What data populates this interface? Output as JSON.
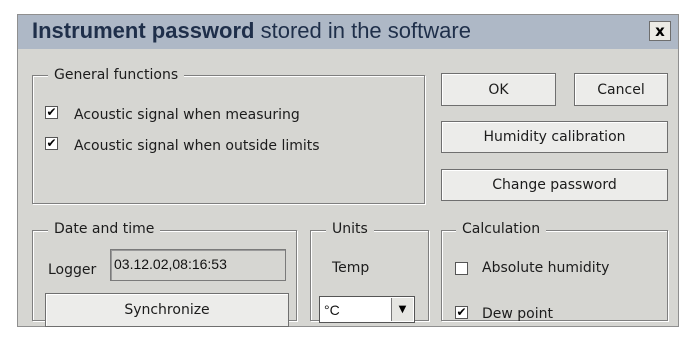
{
  "window": {
    "title_bold": "Instrument password",
    "title_rest": " stored in the software",
    "close_label": "x"
  },
  "general": {
    "legend": "General functions",
    "items": [
      {
        "label": "Acoustic signal when measuring",
        "checked": true
      },
      {
        "label": "Acoustic signal when outside limits",
        "checked": true
      }
    ]
  },
  "buttons": {
    "ok": "OK",
    "cancel": "Cancel",
    "humidity_calibration": "Humidity calibration",
    "change_password": "Change password",
    "synchronize": "Synchronize"
  },
  "datetime": {
    "legend": "Date and time",
    "logger_label": "Logger",
    "logger_value": "03.12.02,08:16:53"
  },
  "units": {
    "legend": "Units",
    "temp_label": "Temp",
    "temp_value": "°C"
  },
  "calculation": {
    "legend": "Calculation",
    "items": [
      {
        "label": "Absolute humidity",
        "checked": false
      },
      {
        "label": "Dew point",
        "checked": true
      }
    ]
  },
  "colors": {
    "dialog_bg": "#d6d6d2",
    "titlebar": "#aeb8c6",
    "title_text": "#1f2f4a"
  }
}
